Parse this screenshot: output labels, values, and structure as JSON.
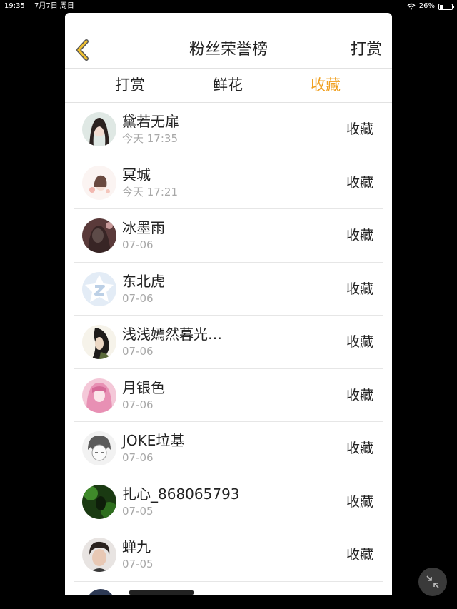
{
  "status": {
    "time": "19:35",
    "date": "7月7日 周日",
    "battery": "26%",
    "battery_level": 0.26
  },
  "header": {
    "title": "粉丝荣誉榜",
    "right_link": "打赏",
    "back_icon": "chevron-left-icon",
    "accent": "#f0a020"
  },
  "tabs": [
    {
      "label": "打赏",
      "active": false
    },
    {
      "label": "鲜花",
      "active": false
    },
    {
      "label": "收藏",
      "active": true
    }
  ],
  "rows": [
    {
      "name": "黛若无扉",
      "time": "今天 17:35",
      "action": "收藏"
    },
    {
      "name": "冥城",
      "time": "今天 17:21",
      "action": "收藏"
    },
    {
      "name": "冰墨雨",
      "time": "07-06",
      "action": "收藏"
    },
    {
      "name": "东北虎",
      "time": "07-06",
      "action": "收藏"
    },
    {
      "name": "浅浅嫣然暮光…",
      "time": "07-06",
      "action": "收藏"
    },
    {
      "name": "月银色",
      "time": "07-06",
      "action": "收藏"
    },
    {
      "name": "JOKE垃基",
      "time": "07-06",
      "action": "收藏"
    },
    {
      "name": "扎心_868065793",
      "time": "07-05",
      "action": "收藏"
    },
    {
      "name": "蝉九",
      "time": "07-05",
      "action": "收藏"
    }
  ]
}
